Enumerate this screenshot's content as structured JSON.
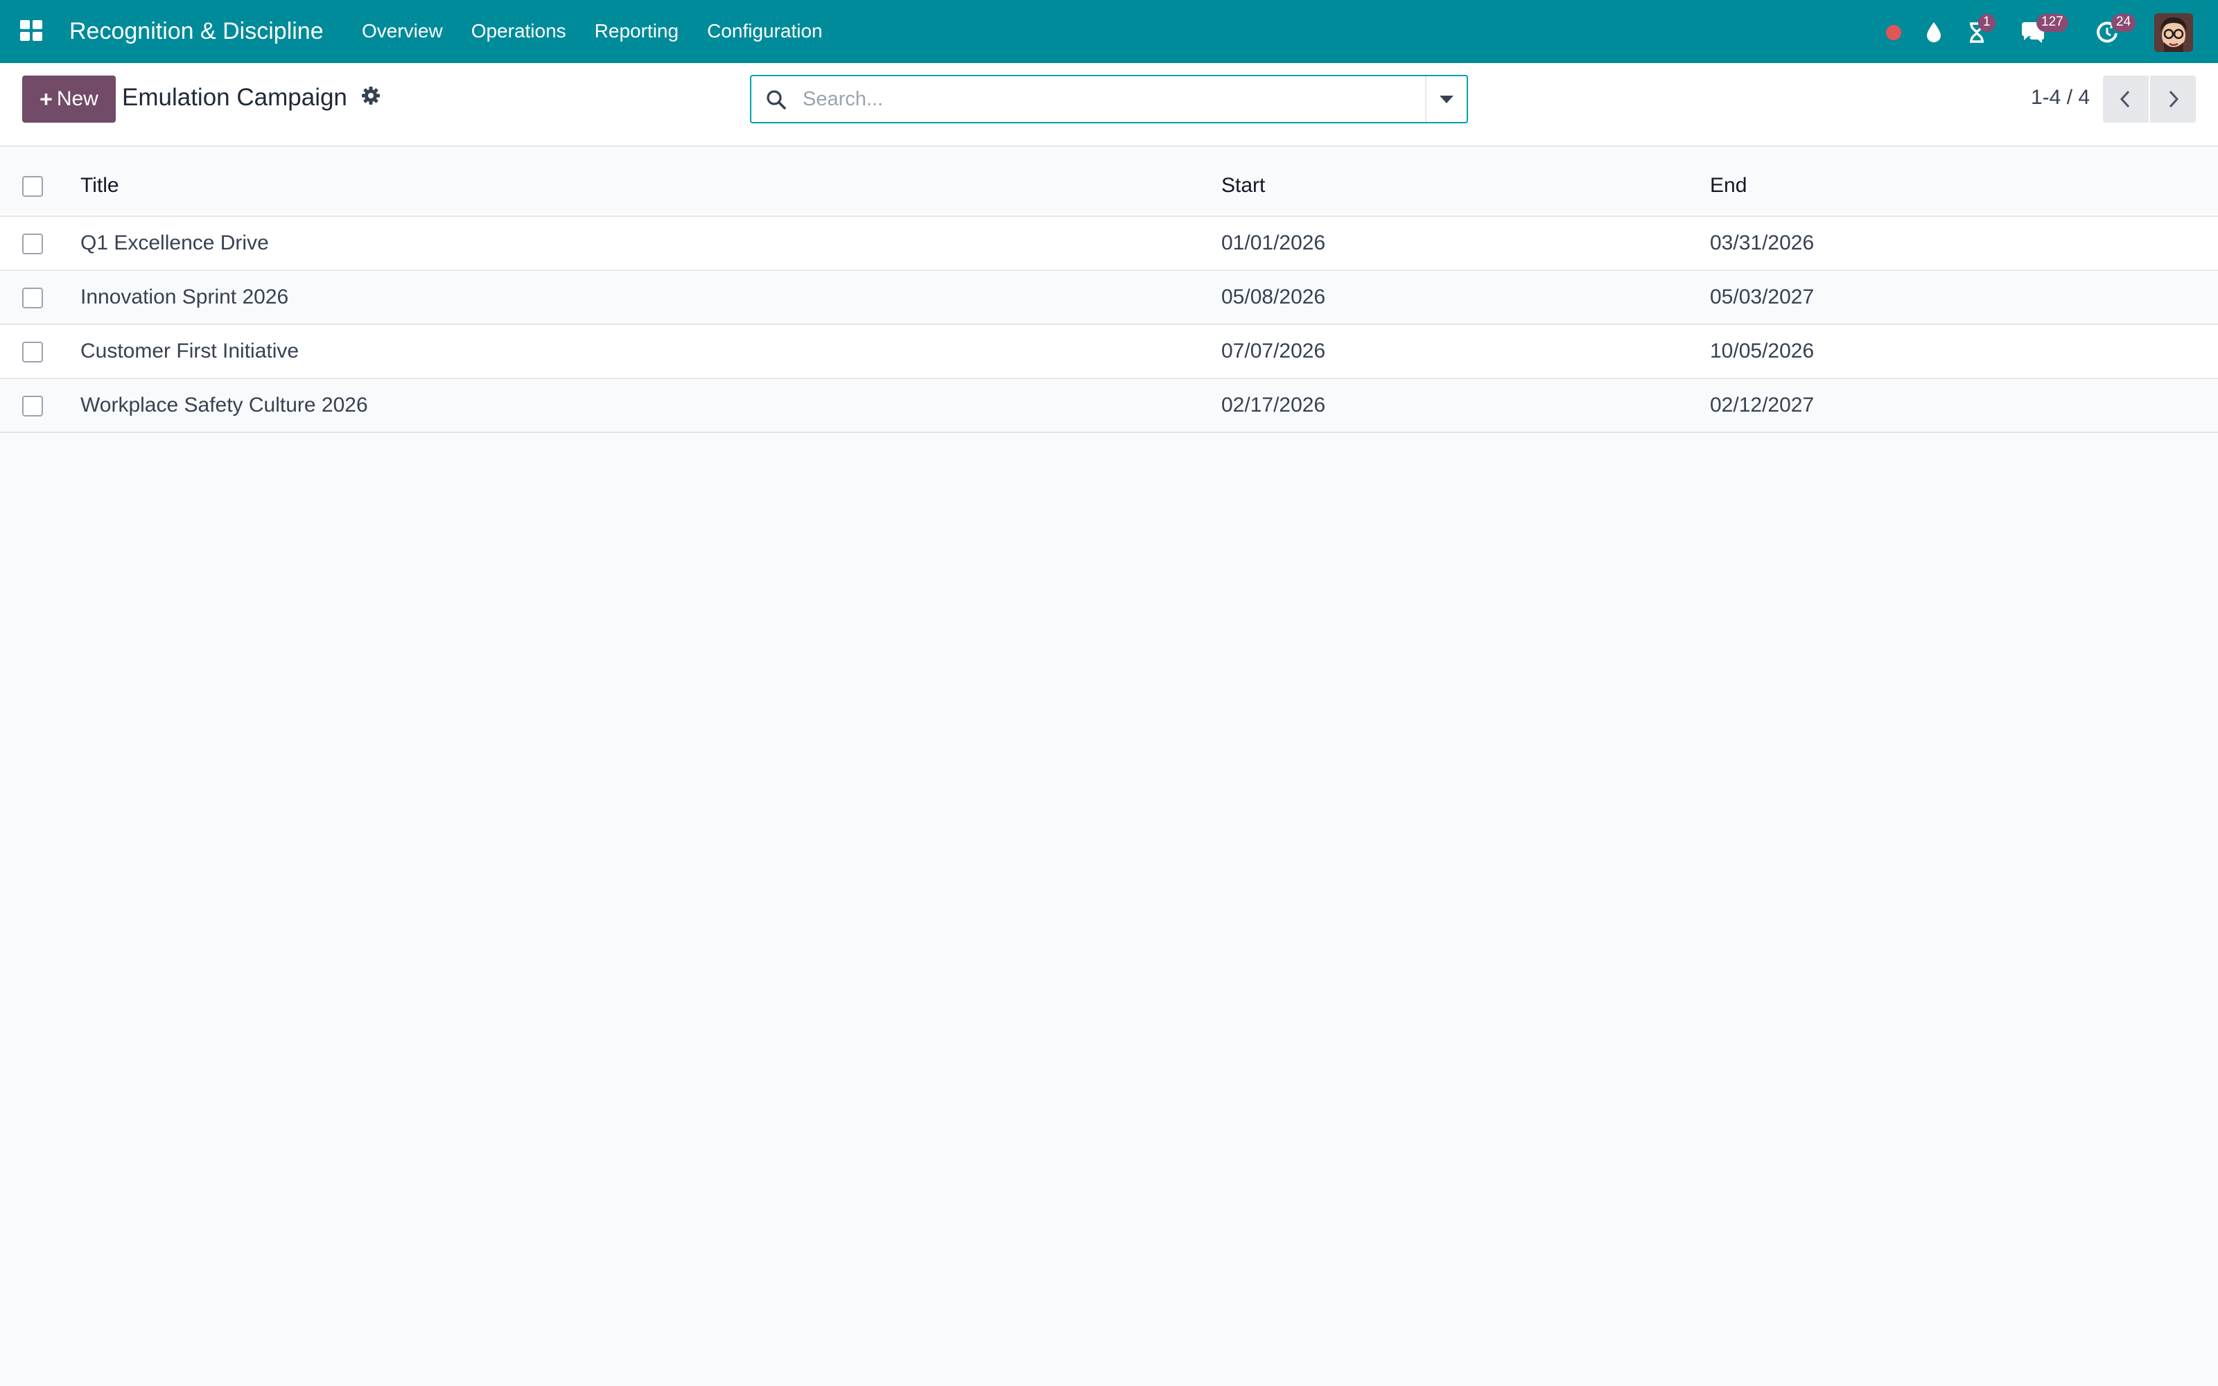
{
  "navbar": {
    "app_title": "Recognition & Discipline",
    "menu": [
      "Overview",
      "Operations",
      "Reporting",
      "Configuration"
    ],
    "activity_badge": "1",
    "messages_badge": "127",
    "updates_badge": "24",
    "colors": {
      "bar": "#008b9a",
      "badge": "#8a4a73",
      "record": "#e05656"
    }
  },
  "control_panel": {
    "new_label": "New",
    "title": "Emulation Campaign",
    "search_placeholder": "Search...",
    "pager": "1-4 / 4",
    "colors": {
      "primary": "#714b67",
      "search_border": "#00a0ae"
    }
  },
  "table": {
    "headers": {
      "title": "Title",
      "start": "Start",
      "end": "End"
    },
    "rows": [
      {
        "title": "Q1 Excellence Drive",
        "start": "01/01/2026",
        "end": "03/31/2026"
      },
      {
        "title": "Innovation Sprint 2026",
        "start": "05/08/2026",
        "end": "05/03/2027"
      },
      {
        "title": "Customer First Initiative",
        "start": "07/07/2026",
        "end": "10/05/2026"
      },
      {
        "title": "Workplace Safety Culture 2026",
        "start": "02/17/2026",
        "end": "02/12/2027"
      }
    ]
  },
  "icons": [
    "apps-icon",
    "record-icon",
    "droplet-icon",
    "hourglass-icon",
    "chat-icon",
    "clock-icon",
    "avatar",
    "gear-icon",
    "search-icon",
    "caret-down-icon",
    "chevron-left-icon",
    "chevron-right-icon"
  ]
}
